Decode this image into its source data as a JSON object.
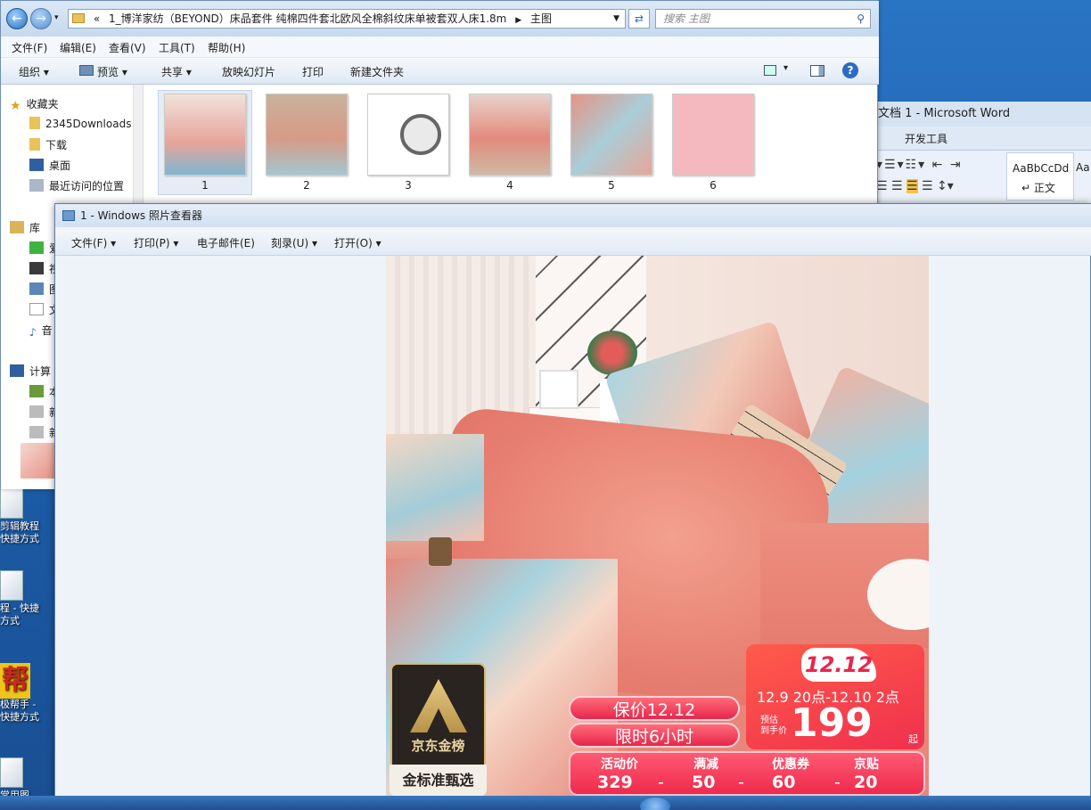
{
  "explorer": {
    "path": "1_博洋家纺（BEYOND）床品套件 纯棉四件套北欧风全棉斜纹床单被套双人床1.8m",
    "path_prefix": "«",
    "path_suffix": "主图",
    "search_placeholder": "搜索 主图",
    "menu": [
      "文件(F)",
      "编辑(E)",
      "查看(V)",
      "工具(T)",
      "帮助(H)"
    ],
    "commands": [
      "组织 ▾",
      "预览 ▾",
      "共享 ▾",
      "放映幻灯片",
      "打印",
      "新建文件夹"
    ],
    "sidebar": {
      "favorites_label": "收藏夹",
      "favorites": [
        "2345Downloads",
        "下载",
        "桌面",
        "最近访问的位置"
      ],
      "library_label": "库",
      "library_items": [
        "爱",
        "视",
        "图",
        "文",
        "音"
      ],
      "computer_label": "计算",
      "computer_items": [
        "本",
        "新",
        "新"
      ]
    },
    "thumbnails": [
      "1",
      "2",
      "3",
      "4",
      "5",
      "6"
    ]
  },
  "word": {
    "title": "文档 1 - Microsoft Word",
    "tab": "开发工具",
    "style1": "AaBbCcDd",
    "style1_label": "↵ 正文",
    "style2": "Aa"
  },
  "desktop_icons": [
    "剪辑教程\n快捷方式",
    "程 - 快捷\n方式",
    "帮",
    "极帮手 -\n快捷方式",
    "常用图"
  ],
  "viewer": {
    "title": "1 - Windows 照片查看器",
    "menu": [
      "文件(F) ▾",
      "打印(P) ▾",
      "电子邮件(E)",
      "刻录(U) ▾",
      "打开(O) ▾"
    ]
  },
  "promo": {
    "badge_line1": "京东金榜",
    "badge_line2": "金标准甄选",
    "tag1": "保价12.12",
    "tag2": "限时6小时",
    "event": "12.12",
    "time_range": "12.9 20点-12.10 2点",
    "est_label_1": "预估",
    "est_label_2": "到手价",
    "price": "199",
    "price_suffix": "起",
    "breakdown_labels": [
      "活动价",
      "满减",
      "优惠券",
      "京贴"
    ],
    "breakdown_values": [
      "329",
      "50",
      "60",
      "20"
    ],
    "breakdown_sep": "-"
  },
  "colors": {
    "accent": "#e8264b",
    "promo_red": "#f03d52",
    "badge_dark": "#2a2420",
    "gold": "#d9b76a"
  }
}
